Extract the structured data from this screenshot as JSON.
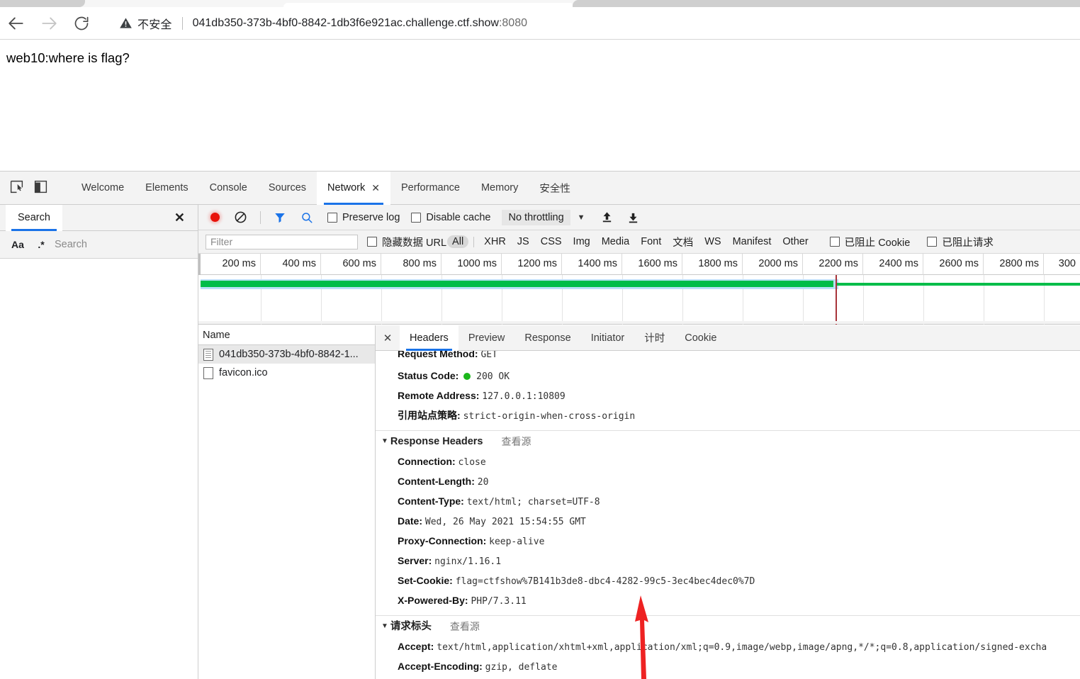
{
  "browser": {
    "back_icon": "back-arrow-icon",
    "forward_icon": "forward-arrow-icon",
    "reload_icon": "reload-icon",
    "security_icon": "warning-triangle-icon",
    "security_label": "不安全",
    "url_host": "041db350-373b-4bf0-8842-1db3f6e921ac.challenge.ctf.show",
    "url_port": ":8080"
  },
  "page": {
    "body_text": "web10:where is flag?"
  },
  "devtools": {
    "inspect_icon": "inspect-element-icon",
    "device_icon": "device-toolbar-icon",
    "tabs": [
      {
        "label": "Welcome",
        "selected": false
      },
      {
        "label": "Elements",
        "selected": false
      },
      {
        "label": "Console",
        "selected": false
      },
      {
        "label": "Sources",
        "selected": false
      },
      {
        "label": "Network",
        "selected": true,
        "close": "✕"
      },
      {
        "label": "Performance",
        "selected": false
      },
      {
        "label": "Memory",
        "selected": false
      },
      {
        "label": "安全性",
        "selected": false
      }
    ],
    "search_drawer": {
      "tab_label": "Search",
      "close_label": "✕",
      "match_case_label": "Aa",
      "regex_label": ".*",
      "input_value": "",
      "input_placeholder": "Search"
    },
    "network_toolbar": {
      "record_icon": "record-button-icon",
      "clear_icon": "clear-network-icon",
      "filter_icon": "filter-funnel-icon",
      "search_icon": "search-magnifier-icon",
      "preserve_log": "Preserve log",
      "disable_cache": "Disable cache",
      "throttling": "No throttling",
      "throttle_caret": "▼",
      "import_icon": "import-har-icon",
      "export_icon": "export-har-icon"
    },
    "filter_bar": {
      "filter_value": "",
      "filter_placeholder": "Filter",
      "hide_data_urls": "隐藏数据 URL",
      "types": [
        "All",
        "XHR",
        "JS",
        "CSS",
        "Img",
        "Media",
        "Font",
        "文档",
        "WS",
        "Manifest",
        "Other"
      ],
      "active_type": "All",
      "blocked_cookies": "已阻止 Cookie",
      "blocked_requests": "已阻止请求"
    },
    "timeline": {
      "ticks": [
        "200 ms",
        "400 ms",
        "600 ms",
        "800 ms",
        "1000 ms",
        "1200 ms",
        "1400 ms",
        "1600 ms",
        "1800 ms",
        "2000 ms",
        "2200 ms",
        "2400 ms",
        "2600 ms",
        "2800 ms",
        "300"
      ],
      "marker_ms": 2200,
      "bar_color": "#00bd49",
      "band_color": "#b8e0f7",
      "marker_color": "#a8343a"
    },
    "requests": {
      "column_name": "Name",
      "rows": [
        {
          "name": "041db350-373b-4bf0-8842-1...",
          "icon": "document-file-icon",
          "selected": true
        },
        {
          "name": "favicon.ico",
          "icon": "generic-file-icon",
          "selected": false
        }
      ]
    },
    "detail": {
      "close_label": "✕",
      "tabs": [
        {
          "label": "Headers",
          "selected": true
        },
        {
          "label": "Preview",
          "selected": false
        },
        {
          "label": "Response",
          "selected": false
        },
        {
          "label": "Initiator",
          "selected": false
        },
        {
          "label": "计时",
          "selected": false
        },
        {
          "label": "Cookie",
          "selected": false
        }
      ],
      "general_rows": [
        {
          "key": "Request Method:",
          "value": "GET",
          "clipped": true
        },
        {
          "key": "Status Code:",
          "value": "200 OK",
          "status_dot": true
        },
        {
          "key": "Remote Address:",
          "value": "127.0.0.1:10809"
        },
        {
          "key": "引用站点策略:",
          "value": "strict-origin-when-cross-origin"
        }
      ],
      "response_section": {
        "title": "Response Headers",
        "arrow": "▼",
        "view_source": "查看源",
        "rows": [
          {
            "key": "Connection:",
            "value": "close"
          },
          {
            "key": "Content-Length:",
            "value": "20"
          },
          {
            "key": "Content-Type:",
            "value": "text/html; charset=UTF-8"
          },
          {
            "key": "Date:",
            "value": "Wed, 26 May 2021 15:54:55 GMT"
          },
          {
            "key": "Proxy-Connection:",
            "value": "keep-alive"
          },
          {
            "key": "Server:",
            "value": "nginx/1.16.1"
          },
          {
            "key": "Set-Cookie:",
            "value": "flag=ctfshow%7B141b3de8-dbc4-4282-99c5-3ec4bec4dec0%7D"
          },
          {
            "key": "X-Powered-By:",
            "value": "PHP/7.3.11"
          }
        ]
      },
      "request_section": {
        "title": "请求标头",
        "arrow": "▼",
        "view_source": "查看源",
        "rows": [
          {
            "key": "Accept:",
            "value": "text/html,application/xhtml+xml,application/xml;q=0.9,image/webp,image/apng,*/*;q=0.8,application/signed-excha"
          },
          {
            "key": "Accept-Encoding:",
            "value": "gzip, deflate"
          }
        ]
      }
    }
  },
  "annotation": {
    "arrow_color": "#ee2222",
    "arrow_name": "red-pointer-arrow"
  }
}
